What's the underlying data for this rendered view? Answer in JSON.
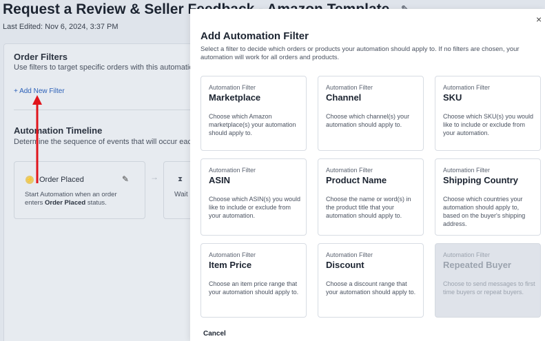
{
  "background": {
    "page_title": "Request a Review & Seller Feedback - Amazon Template",
    "last_edited": "Last Edited: Nov 6, 2024, 3:37 PM",
    "order_filters": {
      "heading": "Order Filters",
      "subtext": "Use filters to target specific orders with this automation",
      "add_filter_label": "+ Add New Filter"
    },
    "timeline": {
      "heading": "Automation Timeline",
      "subtext": "Determine the sequence of events that will occur each",
      "order_placed": {
        "title": "Order Placed",
        "desc_prefix": "Start Automation when an order enters ",
        "desc_bold": "Order Placed",
        "desc_suffix": " status."
      },
      "wait_label": "Wait"
    }
  },
  "modal": {
    "title": "Add Automation Filter",
    "description": "Select a filter to decide which orders or products your automation should apply to. If no filters are chosen, your automation will work for all orders and products.",
    "close_glyph": "×",
    "cancel_label": "Cancel",
    "filters": [
      {
        "kicker": "Automation Filter",
        "name": "Marketplace",
        "desc": "Choose which Amazon marketplace(s) your automation should apply to.",
        "disabled": false
      },
      {
        "kicker": "Automation Filter",
        "name": "Channel",
        "desc": "Choose which channel(s) your automation should apply to.",
        "disabled": false
      },
      {
        "kicker": "Automation Filter",
        "name": "SKU",
        "desc": "Choose which SKU(s) you would like to include or exclude from your automation.",
        "disabled": false
      },
      {
        "kicker": "Automation Filter",
        "name": "ASIN",
        "desc": "Choose which ASIN(s) you would like to include or exclude from your automation.",
        "disabled": false
      },
      {
        "kicker": "Automation Filter",
        "name": "Product Name",
        "desc": "Choose the name or word(s) in the product title that your automation should apply to.",
        "disabled": false
      },
      {
        "kicker": "Automation Filter",
        "name": "Shipping Country",
        "desc": "Choose which countries your automation should apply to, based on the buyer's shipping address.",
        "disabled": false
      },
      {
        "kicker": "Automation Filter",
        "name": "Item Price",
        "desc": "Choose an item price range that your automation should apply to.",
        "disabled": false
      },
      {
        "kicker": "Automation Filter",
        "name": "Discount",
        "desc": "Choose a discount range that your automation should apply to.",
        "disabled": false
      },
      {
        "kicker": "Automation Filter",
        "name": "Repeated Buyer",
        "desc": "Choose to send messages to first time buyers or repeat buyers.",
        "disabled": true
      }
    ]
  },
  "colors": {
    "accent_link": "#2a5fb7",
    "annotation_arrow": "#e0141b",
    "disabled_card": "#dfe3ea"
  }
}
